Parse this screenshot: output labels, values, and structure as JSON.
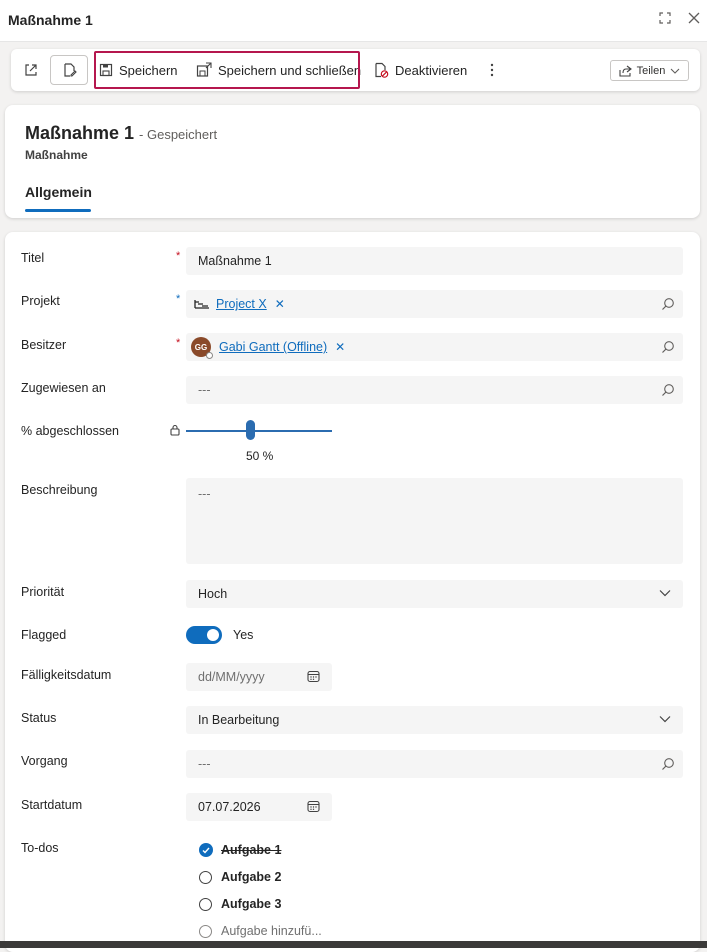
{
  "window": {
    "title": "Maßnahme 1"
  },
  "toolbar": {
    "save": "Speichern",
    "save_close": "Speichern und schließen",
    "deactivate": "Deaktivieren",
    "share": "Teilen"
  },
  "record": {
    "title": "Maßnahme 1",
    "status": "- Gespeichert",
    "entity": "Maßnahme",
    "tab": "Allgemein"
  },
  "form": {
    "title_label": "Titel",
    "title_value": "Maßnahme 1",
    "project_label": "Projekt",
    "project_value": "Project X",
    "owner_label": "Besitzer",
    "owner_initials": "GG",
    "owner_value": "Gabi Gantt (Offline)",
    "assigned_label": "Zugewiesen an",
    "assigned_value": "---",
    "percent_label": "% abgeschlossen",
    "percent_value": "50 %",
    "percent_fraction": 0.5,
    "description_label": "Beschreibung",
    "description_value": "---",
    "priority_label": "Priorität",
    "priority_value": "Hoch",
    "flagged_label": "Flagged",
    "flagged_value": "Yes",
    "due_label": "Fälligkeitsdatum",
    "due_placeholder": "dd/MM/yyyy",
    "status_label": "Status",
    "status_value": "In Bearbeitung",
    "process_label": "Vorgang",
    "process_value": "---",
    "start_label": "Startdatum",
    "start_value": "07.07.2026",
    "todos_label": "To-dos",
    "todos": [
      {
        "label": "Aufgabe 1",
        "done": true
      },
      {
        "label": "Aufgabe 2",
        "done": false
      },
      {
        "label": "Aufgabe 3",
        "done": false
      }
    ],
    "todo_add": "Aufgabe hinzufü..."
  },
  "colors": {
    "accent": "#0f6cbd",
    "highlight": "#b5174e",
    "required": "#c50f1f"
  }
}
